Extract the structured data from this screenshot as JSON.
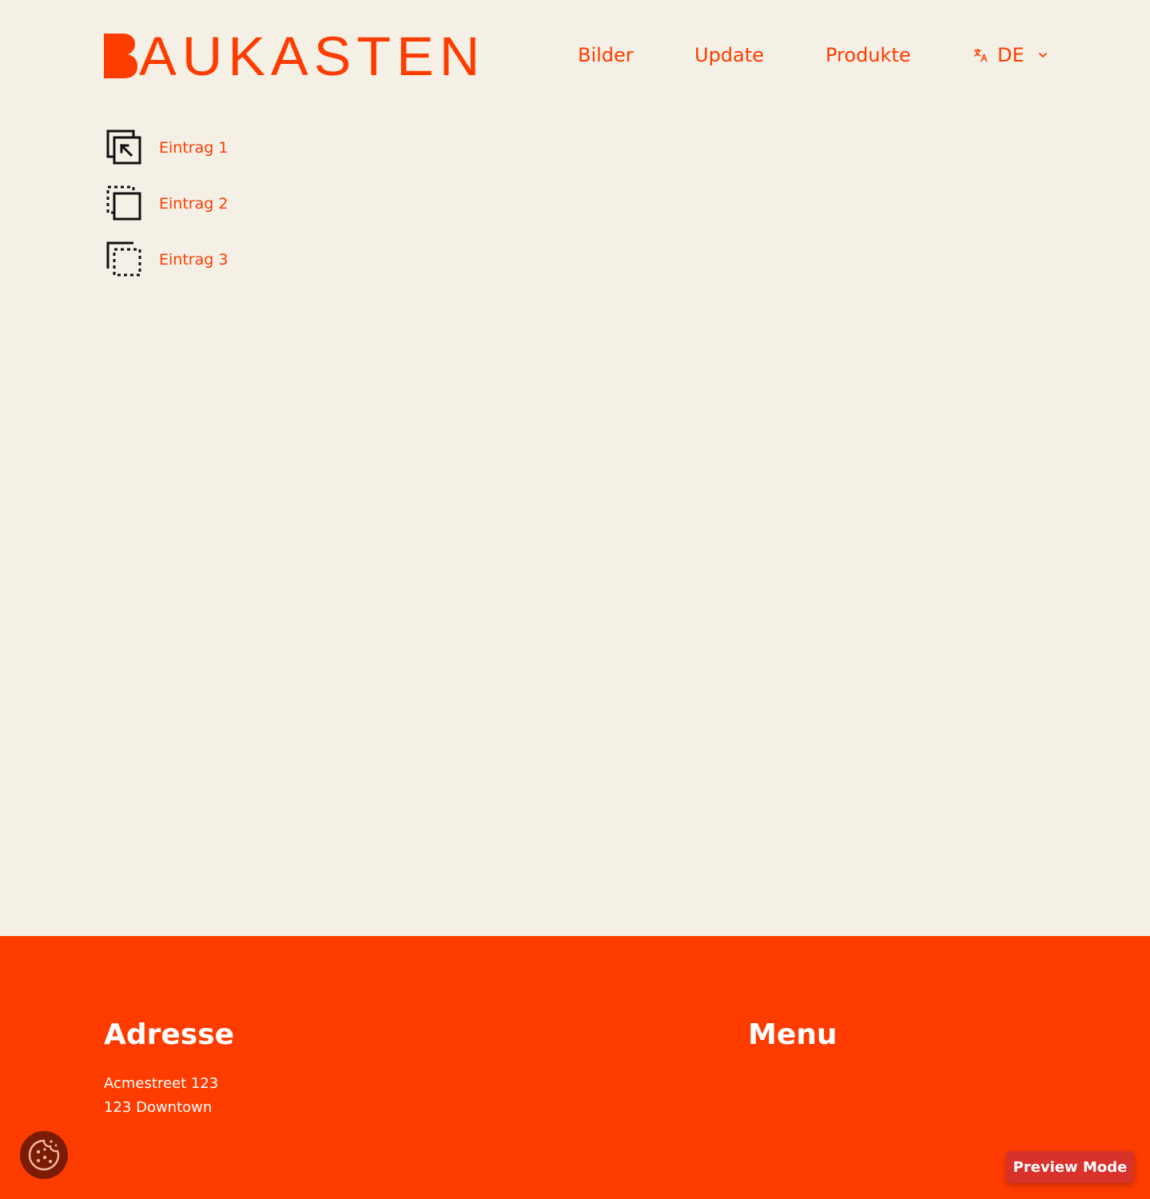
{
  "brand": {
    "logo_text": "AUKASTEN",
    "logo_initial": "B",
    "accent_color": "#ff3c00",
    "background_color": "#f4f0e6"
  },
  "nav": {
    "items": [
      {
        "label": "Bilder"
      },
      {
        "label": "Update"
      },
      {
        "label": "Produkte"
      }
    ],
    "language": {
      "code": "DE",
      "icon": "translate-icon",
      "dropdown_icon": "chevron-down-icon"
    }
  },
  "entries": [
    {
      "label": "Eintrag 1",
      "icon": "external-link-square-icon"
    },
    {
      "label": "Eintrag 2",
      "icon": "dashed-copy-icon"
    },
    {
      "label": "Eintrag 3",
      "icon": "dashed-select-icon"
    }
  ],
  "footer": {
    "address_heading": "Adresse",
    "address_lines": [
      "Acmestreet 123",
      "123 Downtown"
    ],
    "menu_heading": "Menu"
  },
  "cookie_button": {
    "icon": "cookie-icon"
  },
  "preview_button": {
    "label": "Preview Mode"
  }
}
